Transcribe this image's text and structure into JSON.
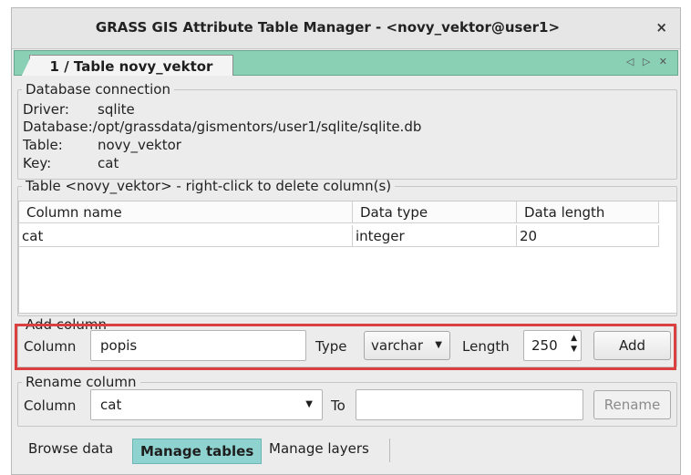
{
  "window": {
    "title": "GRASS GIS Attribute Table Manager - <novy_vektor@user1>",
    "close_glyph": "×"
  },
  "notebook": {
    "tab_label": "1 / Table novy_vektor",
    "nav_arrows": "◁ ▷ ✕"
  },
  "db_connection": {
    "legend": "Database connection",
    "rows": [
      {
        "label": "Driver:",
        "value": "sqlite"
      },
      {
        "label": "Database:",
        "value": "/opt/grassdata/gismentors/user1/sqlite/sqlite.db"
      },
      {
        "label": "Table:",
        "value": "novy_vektor"
      },
      {
        "label": "Key:",
        "value": "cat"
      }
    ]
  },
  "columns_table": {
    "legend": "Table <novy_vektor> - right-click to delete column(s)",
    "headers": [
      "Column name",
      "Data type",
      "Data length"
    ],
    "rows": [
      [
        "cat",
        "integer",
        "20"
      ]
    ]
  },
  "add_column": {
    "legend": "Add column",
    "column_label": "Column",
    "column_value": "popis",
    "type_label": "Type",
    "type_value": "varchar",
    "length_label": "Length",
    "length_value": "250",
    "add_button": "Add"
  },
  "rename_column": {
    "legend": "Rename column",
    "column_label": "Column",
    "column_value": "cat",
    "to_label": "To",
    "to_value": "",
    "rename_button": "Rename"
  },
  "bottom_tabs": [
    "Browse data",
    "Manage tables",
    "Manage layers"
  ],
  "colors": {
    "notebook_accent": "#89d0b4",
    "active_tab": "#8fd3d0",
    "highlight_border": "#d9403f"
  }
}
